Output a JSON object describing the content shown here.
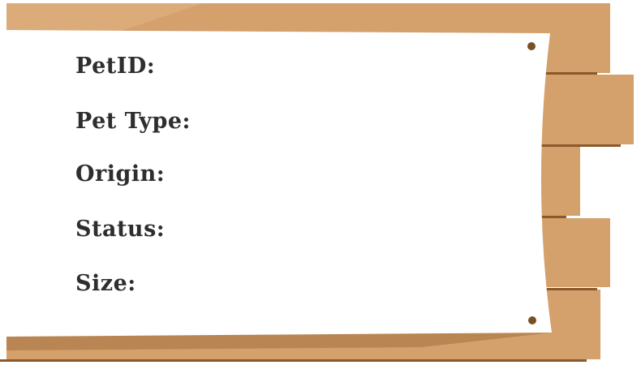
{
  "card": {
    "fields": [
      {
        "label": "PetID:"
      },
      {
        "label": "Pet Type:"
      },
      {
        "label": "Origin:"
      },
      {
        "label": "Status:"
      },
      {
        "label": "Size:"
      }
    ]
  },
  "colors": {
    "wood": "#d4a06c",
    "wood_dark": "#8a5a2a",
    "paper": "#ffffff",
    "pin": "#7a4f22",
    "text": "#2e2e2e"
  }
}
